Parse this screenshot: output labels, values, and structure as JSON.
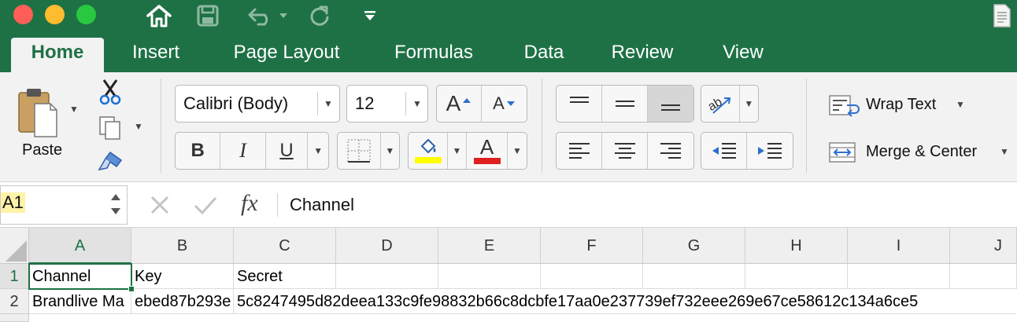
{
  "ribbon": {
    "tabs": [
      {
        "label": "Home",
        "active": true
      },
      {
        "label": "Insert"
      },
      {
        "label": "Page Layout"
      },
      {
        "label": "Formulas"
      },
      {
        "label": "Data"
      },
      {
        "label": "Review"
      },
      {
        "label": "View"
      }
    ],
    "clipboard": {
      "paste_label": "Paste"
    },
    "font": {
      "font_name": "Calibri (Body)",
      "font_size": "12",
      "bold": "B",
      "italic": "I",
      "underline": "U",
      "font_color_glyph": "A",
      "grow_glyph": "A",
      "shrink_glyph": "A"
    },
    "alignment": {
      "wrap_text_label": "Wrap Text",
      "merge_center_label": "Merge & Center"
    }
  },
  "formula_bar": {
    "name_box_value": "A1",
    "fx_label": "fx",
    "formula_value": "Channel"
  },
  "sheet": {
    "columns": [
      "A",
      "B",
      "C",
      "D",
      "E",
      "F",
      "G",
      "H",
      "I",
      "J"
    ],
    "rows": [
      {
        "number": "1",
        "cells": [
          "Channel",
          "Key",
          "Secret"
        ]
      },
      {
        "number": "2",
        "cells": [
          "Brandlive Ma",
          "ebed87b293e",
          "5c8247495d82deea133c9fe98832b66c8dcbfe17aa0e237739ef732eee269e67ce58612c134a6ce5"
        ]
      }
    ],
    "selected_cell": "A1"
  },
  "colors": {
    "brand_green": "#1e7145",
    "highlight_yellow": "#ffff00",
    "font_red": "#e02020"
  }
}
